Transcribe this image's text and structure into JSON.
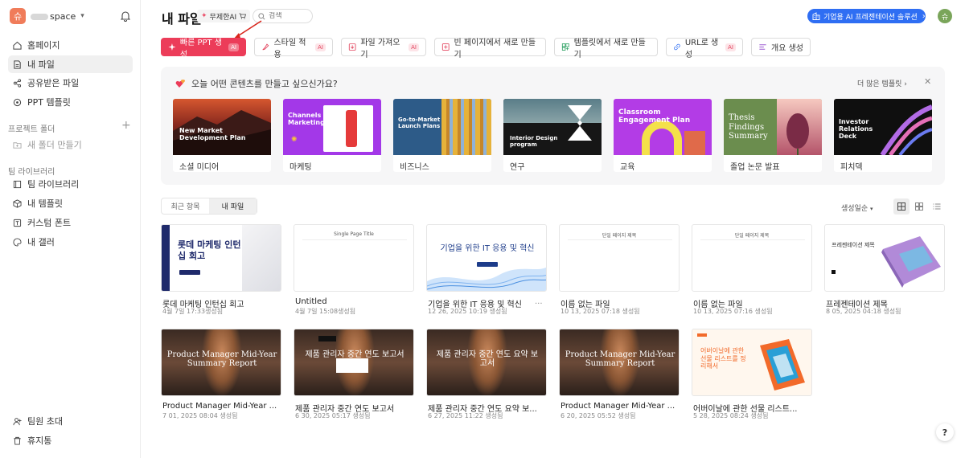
{
  "workspace": {
    "avatar": "슈",
    "name": "space"
  },
  "sidebar": {
    "items": [
      {
        "label": "홈페이지",
        "icon": "home-icon"
      },
      {
        "label": "내 파일",
        "icon": "file-icon",
        "active": true
      },
      {
        "label": "공유받은 파일",
        "icon": "share-icon"
      },
      {
        "label": "PPT 템플릿",
        "icon": "template-icon"
      }
    ],
    "project_folder_label": "프로젝트 폴더",
    "new_folder_label": "새 폴더 만들기",
    "team_library_label": "팀 라이브러리",
    "team_items": [
      {
        "label": "팀 라이브러리",
        "icon": "library-icon"
      },
      {
        "label": "내 템플릿",
        "icon": "box-icon"
      },
      {
        "label": "커스텀 폰트",
        "icon": "font-icon"
      },
      {
        "label": "내 갤러",
        "icon": "palette-icon"
      }
    ],
    "bottom_items": [
      {
        "label": "팀원 초대",
        "icon": "invite-icon"
      },
      {
        "label": "휴지통",
        "icon": "trash-icon"
      }
    ]
  },
  "header": {
    "title": "내 파일",
    "free_badge": "무제한AI",
    "search_placeholder": "검색",
    "enterprise_label": "기업용 AI 프레젠테이션 솔루션",
    "user_avatar": "슈"
  },
  "actions": [
    {
      "label": "빠른 PPT 생성",
      "ai": "AI",
      "primary": true,
      "icon": "sparkle-icon"
    },
    {
      "label": "스타일 적용",
      "ai": "AI",
      "icon": "brush-icon"
    },
    {
      "label": "파일 가져오기",
      "ai": "AI",
      "icon": "import-icon"
    },
    {
      "label": "빈 페이지에서 새로 만들기",
      "ai": "",
      "icon": "plus-square-icon"
    },
    {
      "label": "템플릿에서 새로 만들기",
      "ai": "",
      "icon": "template-grid-icon"
    },
    {
      "label": "URL로 생성",
      "ai": "AI",
      "icon": "link-icon"
    },
    {
      "label": "개요 생성",
      "ai": "",
      "icon": "outline-icon"
    }
  ],
  "templates": {
    "prompt": "오늘 어떤 콘텐츠를 만들고 싶으신가요?",
    "more_label": "더 많은 템플릿",
    "cards": [
      {
        "label": "소셜 미디어",
        "thumb_text": "New Market Development Plan"
      },
      {
        "label": "마케팅",
        "thumb_text": "Channels Marketing"
      },
      {
        "label": "비즈니스",
        "thumb_text": "Go-to-Market Launch Plans"
      },
      {
        "label": "연구",
        "thumb_text": "Interior Design program"
      },
      {
        "label": "교육",
        "thumb_text": "Classroom Engagement Plan"
      },
      {
        "label": "졸업 논문 발표",
        "thumb_text": "Thesis Findings Summary"
      },
      {
        "label": "피치덱",
        "thumb_text": "Investor Relations Deck"
      }
    ]
  },
  "tabs": [
    {
      "label": "최근 항목"
    },
    {
      "label": "내 파일",
      "active": true
    }
  ],
  "sort_label": "생성일순",
  "files": [
    {
      "name": "롯데 마케팅 인턴십 회고",
      "date": "4월 7일 17:33생성됨",
      "thumb_text": "롯데 마케팅 인턴십 회고"
    },
    {
      "name": "Untitled",
      "date": "4월 7일 15:08생성됨",
      "thumb_text": "Single Page Title"
    },
    {
      "name": "기업을 위한 IT 응용 및 혁신",
      "date": "12 26, 2025 10:19 생성됨",
      "thumb_text": "기업을 위한 IT 응용 및 혁신"
    },
    {
      "name": "이름 없는 파일",
      "date": "10 13, 2025 07:18 생성됨",
      "thumb_text": "단일 페이지 제목"
    },
    {
      "name": "이름 없는 파일",
      "date": "10 13, 2025 07:16 생성됨",
      "thumb_text": "단일 페이지 제목"
    },
    {
      "name": "프레젠테이션 제목",
      "date": "8 05, 2025 04:18 생성됨",
      "thumb_text": "프레젠테이션 제목"
    },
    {
      "name": "Product Manager Mid-Year ...",
      "date": "7 01, 2025 08:04 생성됨",
      "thumb_text": "Product Manager Mid-Year Summary Report"
    },
    {
      "name": "제품 관리자 중간 연도 보고서",
      "date": "6 30, 2025 05:17 생성됨",
      "thumb_text": "제품 관리자 중간 연도 보고서"
    },
    {
      "name": "제품 관리자 중간 연도 요약 보...",
      "date": "6 27, 2025 11:22 생성됨",
      "thumb_text": "제품 관리자 중간 연도 요약 보고서"
    },
    {
      "name": "Product Manager Mid-Year ...",
      "date": "6 20, 2025 05:52 생성됨",
      "thumb_text": "Product Manager Mid-Year Summary Report"
    },
    {
      "name": "어버이날에 관한 선물 리스트...",
      "date": "5 28, 2025 08:24 생성됨",
      "thumb_text": "어버이날에 관한 선물 리스트를 정리해서"
    }
  ],
  "colors": {
    "primary": "#ec3c59",
    "enterprise": "#2f6ef3",
    "ai_tag": "#e2445d"
  }
}
